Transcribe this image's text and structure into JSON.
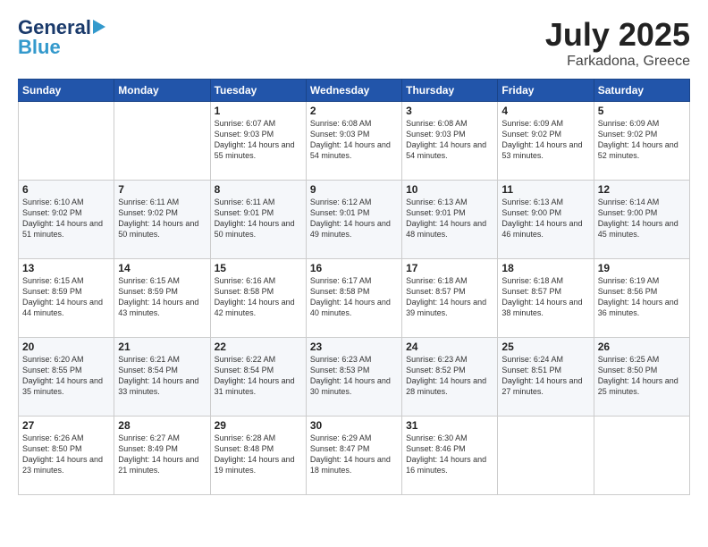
{
  "header": {
    "logo_main": "General",
    "logo_sub": "Blue",
    "month": "July 2025",
    "location": "Farkadona, Greece"
  },
  "weekdays": [
    "Sunday",
    "Monday",
    "Tuesday",
    "Wednesday",
    "Thursday",
    "Friday",
    "Saturday"
  ],
  "weeks": [
    [
      {
        "day": "",
        "info": ""
      },
      {
        "day": "",
        "info": ""
      },
      {
        "day": "1",
        "info": "Sunrise: 6:07 AM\nSunset: 9:03 PM\nDaylight: 14 hours and 55 minutes."
      },
      {
        "day": "2",
        "info": "Sunrise: 6:08 AM\nSunset: 9:03 PM\nDaylight: 14 hours and 54 minutes."
      },
      {
        "day": "3",
        "info": "Sunrise: 6:08 AM\nSunset: 9:03 PM\nDaylight: 14 hours and 54 minutes."
      },
      {
        "day": "4",
        "info": "Sunrise: 6:09 AM\nSunset: 9:02 PM\nDaylight: 14 hours and 53 minutes."
      },
      {
        "day": "5",
        "info": "Sunrise: 6:09 AM\nSunset: 9:02 PM\nDaylight: 14 hours and 52 minutes."
      }
    ],
    [
      {
        "day": "6",
        "info": "Sunrise: 6:10 AM\nSunset: 9:02 PM\nDaylight: 14 hours and 51 minutes."
      },
      {
        "day": "7",
        "info": "Sunrise: 6:11 AM\nSunset: 9:02 PM\nDaylight: 14 hours and 50 minutes."
      },
      {
        "day": "8",
        "info": "Sunrise: 6:11 AM\nSunset: 9:01 PM\nDaylight: 14 hours and 50 minutes."
      },
      {
        "day": "9",
        "info": "Sunrise: 6:12 AM\nSunset: 9:01 PM\nDaylight: 14 hours and 49 minutes."
      },
      {
        "day": "10",
        "info": "Sunrise: 6:13 AM\nSunset: 9:01 PM\nDaylight: 14 hours and 48 minutes."
      },
      {
        "day": "11",
        "info": "Sunrise: 6:13 AM\nSunset: 9:00 PM\nDaylight: 14 hours and 46 minutes."
      },
      {
        "day": "12",
        "info": "Sunrise: 6:14 AM\nSunset: 9:00 PM\nDaylight: 14 hours and 45 minutes."
      }
    ],
    [
      {
        "day": "13",
        "info": "Sunrise: 6:15 AM\nSunset: 8:59 PM\nDaylight: 14 hours and 44 minutes."
      },
      {
        "day": "14",
        "info": "Sunrise: 6:15 AM\nSunset: 8:59 PM\nDaylight: 14 hours and 43 minutes."
      },
      {
        "day": "15",
        "info": "Sunrise: 6:16 AM\nSunset: 8:58 PM\nDaylight: 14 hours and 42 minutes."
      },
      {
        "day": "16",
        "info": "Sunrise: 6:17 AM\nSunset: 8:58 PM\nDaylight: 14 hours and 40 minutes."
      },
      {
        "day": "17",
        "info": "Sunrise: 6:18 AM\nSunset: 8:57 PM\nDaylight: 14 hours and 39 minutes."
      },
      {
        "day": "18",
        "info": "Sunrise: 6:18 AM\nSunset: 8:57 PM\nDaylight: 14 hours and 38 minutes."
      },
      {
        "day": "19",
        "info": "Sunrise: 6:19 AM\nSunset: 8:56 PM\nDaylight: 14 hours and 36 minutes."
      }
    ],
    [
      {
        "day": "20",
        "info": "Sunrise: 6:20 AM\nSunset: 8:55 PM\nDaylight: 14 hours and 35 minutes."
      },
      {
        "day": "21",
        "info": "Sunrise: 6:21 AM\nSunset: 8:54 PM\nDaylight: 14 hours and 33 minutes."
      },
      {
        "day": "22",
        "info": "Sunrise: 6:22 AM\nSunset: 8:54 PM\nDaylight: 14 hours and 31 minutes."
      },
      {
        "day": "23",
        "info": "Sunrise: 6:23 AM\nSunset: 8:53 PM\nDaylight: 14 hours and 30 minutes."
      },
      {
        "day": "24",
        "info": "Sunrise: 6:23 AM\nSunset: 8:52 PM\nDaylight: 14 hours and 28 minutes."
      },
      {
        "day": "25",
        "info": "Sunrise: 6:24 AM\nSunset: 8:51 PM\nDaylight: 14 hours and 27 minutes."
      },
      {
        "day": "26",
        "info": "Sunrise: 6:25 AM\nSunset: 8:50 PM\nDaylight: 14 hours and 25 minutes."
      }
    ],
    [
      {
        "day": "27",
        "info": "Sunrise: 6:26 AM\nSunset: 8:50 PM\nDaylight: 14 hours and 23 minutes."
      },
      {
        "day": "28",
        "info": "Sunrise: 6:27 AM\nSunset: 8:49 PM\nDaylight: 14 hours and 21 minutes."
      },
      {
        "day": "29",
        "info": "Sunrise: 6:28 AM\nSunset: 8:48 PM\nDaylight: 14 hours and 19 minutes."
      },
      {
        "day": "30",
        "info": "Sunrise: 6:29 AM\nSunset: 8:47 PM\nDaylight: 14 hours and 18 minutes."
      },
      {
        "day": "31",
        "info": "Sunrise: 6:30 AM\nSunset: 8:46 PM\nDaylight: 14 hours and 16 minutes."
      },
      {
        "day": "",
        "info": ""
      },
      {
        "day": "",
        "info": ""
      }
    ]
  ]
}
